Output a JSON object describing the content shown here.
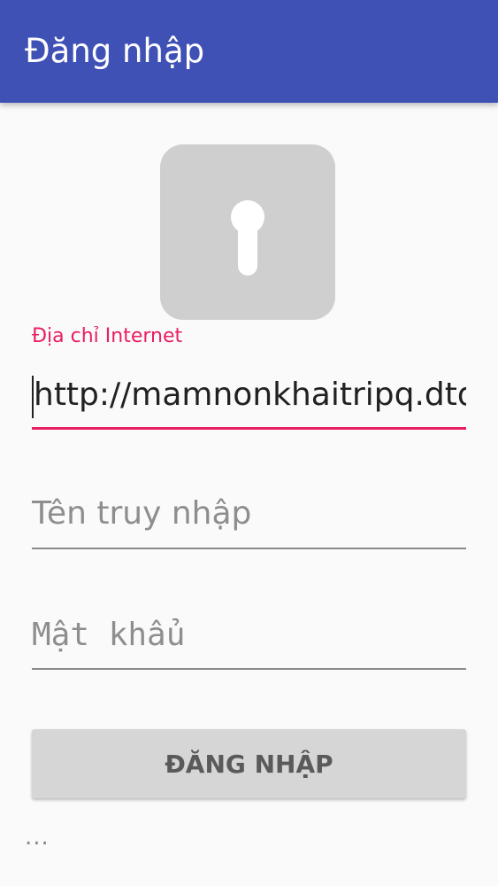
{
  "appbar": {
    "title": "Đăng nhập"
  },
  "form": {
    "url_label": "Địa chỉ Internet",
    "url_value": "http://mamnonkhaitripq.dtdns.net",
    "username_placeholder": "Tên truy nhập",
    "password_placeholder": "Mật khẩu",
    "login_button": "ĐĂNG NHẬP"
  },
  "footer": {
    "more_text": "..."
  },
  "colors": {
    "primary": "#3f51b5",
    "accent": "#e91e63",
    "lock_bg": "#cfcfcf",
    "button_bg": "#d6d6d6"
  },
  "icons": {
    "lock": "keyhole-lock-icon"
  }
}
